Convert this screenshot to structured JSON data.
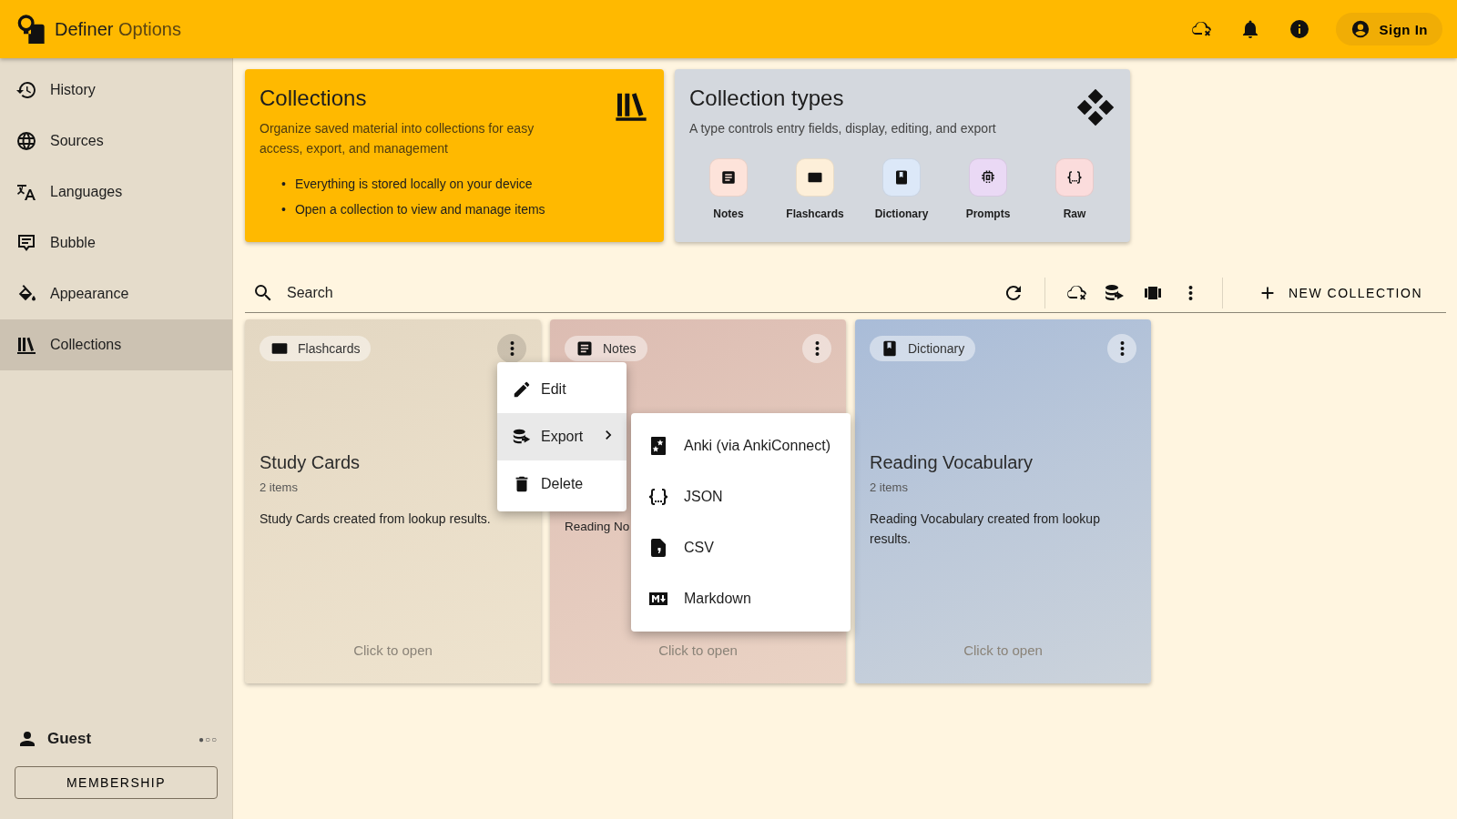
{
  "app_bar": {
    "title": "Definer",
    "subtitle": "Options",
    "sign_in": "Sign In"
  },
  "sidebar": {
    "items": [
      {
        "label": "History",
        "selected": false
      },
      {
        "label": "Sources",
        "selected": false
      },
      {
        "label": "Languages",
        "selected": false
      },
      {
        "label": "Bubble",
        "selected": false
      },
      {
        "label": "Appearance",
        "selected": false
      },
      {
        "label": "Collections",
        "selected": true
      }
    ],
    "user": {
      "name": "Guest",
      "tier": "●○○"
    },
    "membership_button": "MEMBERSHIP"
  },
  "intro_card": {
    "title": "Collections",
    "description": "Organize saved material into collections for easy access, export, and management",
    "bullet_marker": "•",
    "bullets": [
      "Everything is stored locally on your device",
      "Open a collection to view and manage items"
    ]
  },
  "types_card": {
    "title": "Collection types",
    "description": "A type controls entry fields, display, editing, and export",
    "types": [
      {
        "label": "Notes",
        "color": "#fde3da"
      },
      {
        "label": "Flashcards",
        "color": "#fdefd9"
      },
      {
        "label": "Dictionary",
        "color": "#dce8f8"
      },
      {
        "label": "Prompts",
        "color": "#ead9f5"
      },
      {
        "label": "Raw",
        "color": "#fbdcdc"
      }
    ]
  },
  "toolbar": {
    "search_placeholder": "Search",
    "new_button": "NEW COLLECTION"
  },
  "collections": [
    {
      "type": "Flashcards",
      "color": "#e3d7c2",
      "title": "Study Cards",
      "count": "2 items",
      "description": "Study Cards created from lookup results.",
      "footer": "Click to open",
      "menu_open": true
    },
    {
      "type": "Notes",
      "color": "#dcbcb2",
      "description": "Reading No",
      "footer": "Click to open",
      "menu_open": false
    },
    {
      "type": "Dictionary",
      "color": "#a9bcd8",
      "title": "Reading Vocabulary",
      "count": "2 items",
      "description": "Reading Vocabulary created from lookup results.",
      "footer": "Click to open",
      "menu_open": false
    }
  ],
  "context_menu": {
    "items": [
      {
        "label": "Edit",
        "selected": false,
        "submenu": false
      },
      {
        "label": "Export",
        "selected": true,
        "submenu": true
      },
      {
        "label": "Delete",
        "selected": false,
        "submenu": false
      }
    ]
  },
  "export_menu": {
    "items": [
      {
        "label": "Anki (via AnkiConnect)"
      },
      {
        "label": "JSON"
      },
      {
        "label": "CSV"
      },
      {
        "label": "Markdown"
      }
    ]
  }
}
